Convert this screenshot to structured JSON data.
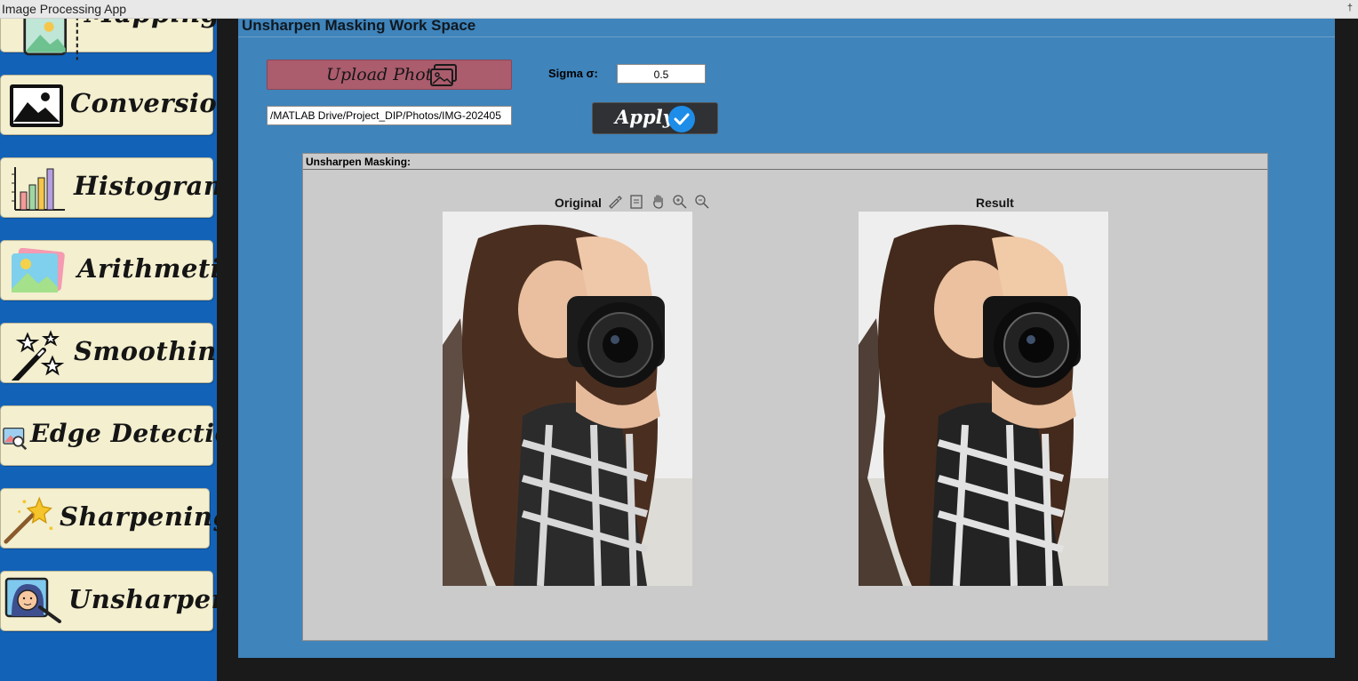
{
  "window": {
    "title": "Image Processing App",
    "pin_glyph": "†"
  },
  "sidebar": {
    "items": [
      {
        "label": "Mapping",
        "icon": "mapping-image-icon"
      },
      {
        "label": "Conversion",
        "icon": "image-icon"
      },
      {
        "label": "Histogram",
        "icon": "bar-chart-icon"
      },
      {
        "label": "Arithmetic",
        "icon": "photos-icon"
      },
      {
        "label": "Smoothing",
        "icon": "magic-wand-stars-icon"
      },
      {
        "label": "Edge Detection",
        "icon": "image-search-icon"
      },
      {
        "label": "Sharpening",
        "icon": "magic-wand-icon"
      },
      {
        "label": "Unsharpen",
        "icon": "portrait-wand-icon"
      }
    ]
  },
  "workspace": {
    "title": "Unsharpen Masking Work Space",
    "upload_label": "Upload Photo",
    "file_path": "/MATLAB Drive/Project_DIP/Photos/IMG-202405",
    "sigma_label": "Sigma σ:",
    "sigma_value": "0.5",
    "apply_label": "Apply"
  },
  "panel": {
    "title": "Unsharpen Masking:",
    "original_title": "Original",
    "result_title": "Result",
    "toolbar": [
      "brush-icon",
      "export-icon",
      "pan-icon",
      "zoom-in-icon",
      "zoom-out-icon",
      "home-icon"
    ]
  },
  "colors": {
    "sidebar_bg": "#1262b8",
    "button_bg": "#f3efcf",
    "workspace_bg": "#3f84bb",
    "upload_bg": "#ab5c6d",
    "apply_bg": "#2f3134",
    "apply_check": "#1e8de8",
    "panel_bg": "#cbcbcb"
  }
}
